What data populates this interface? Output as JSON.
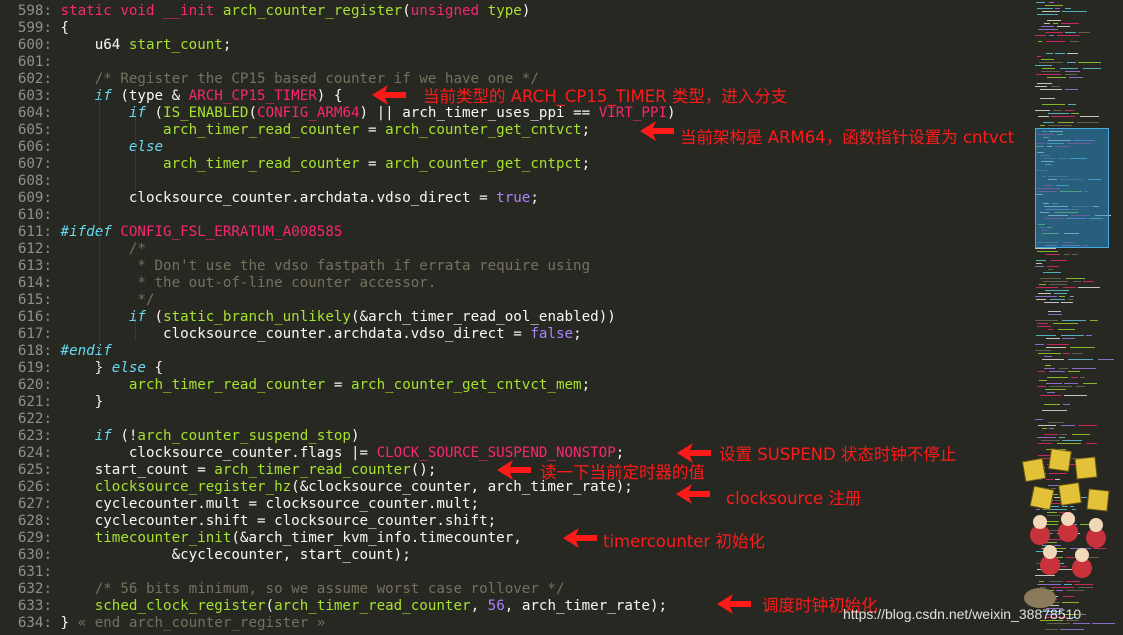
{
  "lines": [
    {
      "n": "598:",
      "segs": [
        [
          "kw",
          "static void __init "
        ],
        [
          "fn",
          "arch_counter_register"
        ],
        [
          "code",
          "("
        ],
        [
          "kw",
          "unsigned"
        ],
        [
          "code",
          " "
        ],
        [
          "fn",
          "type"
        ],
        [
          "code",
          ")"
        ]
      ]
    },
    {
      "n": "599:",
      "segs": [
        [
          "code",
          "{"
        ]
      ]
    },
    {
      "n": "600:",
      "segs": [
        [
          "code",
          "    u64 "
        ],
        [
          "fn",
          "start_count"
        ],
        [
          "code",
          ";"
        ]
      ]
    },
    {
      "n": "601:",
      "segs": []
    },
    {
      "n": "602:",
      "segs": [
        [
          "cmt",
          "    /* Register the CP15 based counter if we have one */"
        ]
      ]
    },
    {
      "n": "603:",
      "segs": [
        [
          "ty",
          "    if"
        ],
        [
          "code",
          " (type & "
        ],
        [
          "mac",
          "ARCH_CP15_TIMER"
        ],
        [
          "code",
          ") {"
        ]
      ]
    },
    {
      "n": "604:",
      "segs": [
        [
          "ty",
          "        if"
        ],
        [
          "code",
          " ("
        ],
        [
          "fn",
          "IS_ENABLED"
        ],
        [
          "code",
          "("
        ],
        [
          "mac",
          "CONFIG_ARM64"
        ],
        [
          "code",
          ") || arch_timer_uses_ppi == "
        ],
        [
          "mac",
          "VIRT_PPI"
        ],
        [
          "code",
          ")"
        ]
      ]
    },
    {
      "n": "605:",
      "segs": [
        [
          "fn",
          "            arch_timer_read_counter"
        ],
        [
          "code",
          " = "
        ],
        [
          "fn",
          "arch_counter_get_cntvct"
        ],
        [
          "code",
          ";"
        ]
      ]
    },
    {
      "n": "606:",
      "segs": [
        [
          "ty",
          "        else"
        ]
      ]
    },
    {
      "n": "607:",
      "segs": [
        [
          "fn",
          "            arch_timer_read_counter"
        ],
        [
          "code",
          " = "
        ],
        [
          "fn",
          "arch_counter_get_cntpct"
        ],
        [
          "code",
          ";"
        ]
      ]
    },
    {
      "n": "608:",
      "segs": []
    },
    {
      "n": "609:",
      "segs": [
        [
          "code",
          "        clocksource_counter.archdata.vdso_direct = "
        ],
        [
          "num",
          "true"
        ],
        [
          "code",
          ";"
        ]
      ]
    },
    {
      "n": "610:",
      "segs": []
    },
    {
      "n": "611:",
      "segs": [
        [
          "ty",
          "#ifdef"
        ],
        [
          "code",
          " "
        ],
        [
          "mac",
          "CONFIG_FSL_ERRATUM_A008585"
        ]
      ]
    },
    {
      "n": "612:",
      "segs": [
        [
          "cmt",
          "        /*"
        ]
      ]
    },
    {
      "n": "613:",
      "segs": [
        [
          "cmt",
          "         * Don't use the vdso fastpath if errata require using"
        ]
      ]
    },
    {
      "n": "614:",
      "segs": [
        [
          "cmt",
          "         * the out-of-line counter accessor."
        ]
      ]
    },
    {
      "n": "615:",
      "segs": [
        [
          "cmt",
          "         */"
        ]
      ]
    },
    {
      "n": "616:",
      "segs": [
        [
          "ty",
          "        if"
        ],
        [
          "code",
          " ("
        ],
        [
          "fn",
          "static_branch_unlikely"
        ],
        [
          "code",
          "(&arch_timer_read_ool_enabled))"
        ]
      ]
    },
    {
      "n": "617:",
      "segs": [
        [
          "code",
          "            clocksource_counter.archdata.vdso_direct = "
        ],
        [
          "num",
          "false"
        ],
        [
          "code",
          ";"
        ]
      ]
    },
    {
      "n": "618:",
      "segs": [
        [
          "ty",
          "#endif"
        ]
      ]
    },
    {
      "n": "619:",
      "segs": [
        [
          "code",
          "    } "
        ],
        [
          "ty",
          "else"
        ],
        [
          "code",
          " {"
        ]
      ]
    },
    {
      "n": "620:",
      "segs": [
        [
          "fn",
          "        arch_timer_read_counter"
        ],
        [
          "code",
          " = "
        ],
        [
          "fn",
          "arch_counter_get_cntvct_mem"
        ],
        [
          "code",
          ";"
        ]
      ]
    },
    {
      "n": "621:",
      "segs": [
        [
          "code",
          "    }"
        ]
      ]
    },
    {
      "n": "622:",
      "segs": []
    },
    {
      "n": "623:",
      "segs": [
        [
          "ty",
          "    if"
        ],
        [
          "code",
          " (!"
        ],
        [
          "fn",
          "arch_counter_suspend_stop"
        ],
        [
          "code",
          ")"
        ]
      ]
    },
    {
      "n": "624:",
      "segs": [
        [
          "code",
          "        clocksource_counter.flags |= "
        ],
        [
          "mac",
          "CLOCK_SOURCE_SUSPEND_NONSTOP"
        ],
        [
          "code",
          ";"
        ]
      ]
    },
    {
      "n": "625:",
      "segs": [
        [
          "code",
          "    start_count = "
        ],
        [
          "fn",
          "arch_timer_read_counter"
        ],
        [
          "code",
          "();"
        ]
      ]
    },
    {
      "n": "626:",
      "segs": [
        [
          "fn",
          "    clocksource_register_hz"
        ],
        [
          "code",
          "(&clocksource_counter, arch_timer_rate);"
        ]
      ]
    },
    {
      "n": "627:",
      "segs": [
        [
          "code",
          "    cyclecounter.mult = clocksource_counter.mult;"
        ]
      ]
    },
    {
      "n": "628:",
      "segs": [
        [
          "code",
          "    cyclecounter.shift = clocksource_counter.shift;"
        ]
      ]
    },
    {
      "n": "629:",
      "segs": [
        [
          "fn",
          "    timecounter_init"
        ],
        [
          "code",
          "(&arch_timer_kvm_info.timecounter,"
        ]
      ]
    },
    {
      "n": "630:",
      "segs": [
        [
          "code",
          "             &cyclecounter, start_count);"
        ]
      ]
    },
    {
      "n": "631:",
      "segs": []
    },
    {
      "n": "632:",
      "segs": [
        [
          "cmt",
          "    /* 56 bits minimum, so we assume worst case rollover */"
        ]
      ]
    },
    {
      "n": "633:",
      "segs": [
        [
          "fn",
          "    sched_clock_register"
        ],
        [
          "code",
          "("
        ],
        [
          "fn",
          "arch_timer_read_counter"
        ],
        [
          "code",
          ", "
        ],
        [
          "num",
          "56"
        ],
        [
          "code",
          ", arch_timer_rate);"
        ]
      ]
    },
    {
      "n": "634:",
      "segs": [
        [
          "code",
          "} "
        ],
        [
          "cmt",
          "« end arch_counter_register »"
        ]
      ]
    }
  ],
  "annotations": {
    "a603": "当前类型的 ARCH_CP15_TIMER 类型，进入分支",
    "a605": "当前架构是 ARM64，函数指针设置为 cntvct",
    "a624": "设置 SUSPEND 状态时钟不停止",
    "a625": "读一下当前定时器的值",
    "a626": "clocksource 注册",
    "a629": "timercounter 初始化",
    "a633": "调度时钟初始化"
  },
  "watermark": "https://blog.csdn.net/weixin_38878510",
  "colors": {
    "background": "#272822",
    "keyword": "#f92672",
    "type": "#66d9ef",
    "function": "#a6e22e",
    "number": "#ae81ff",
    "comment": "#75715e",
    "annotation": "#ff1a1a"
  }
}
